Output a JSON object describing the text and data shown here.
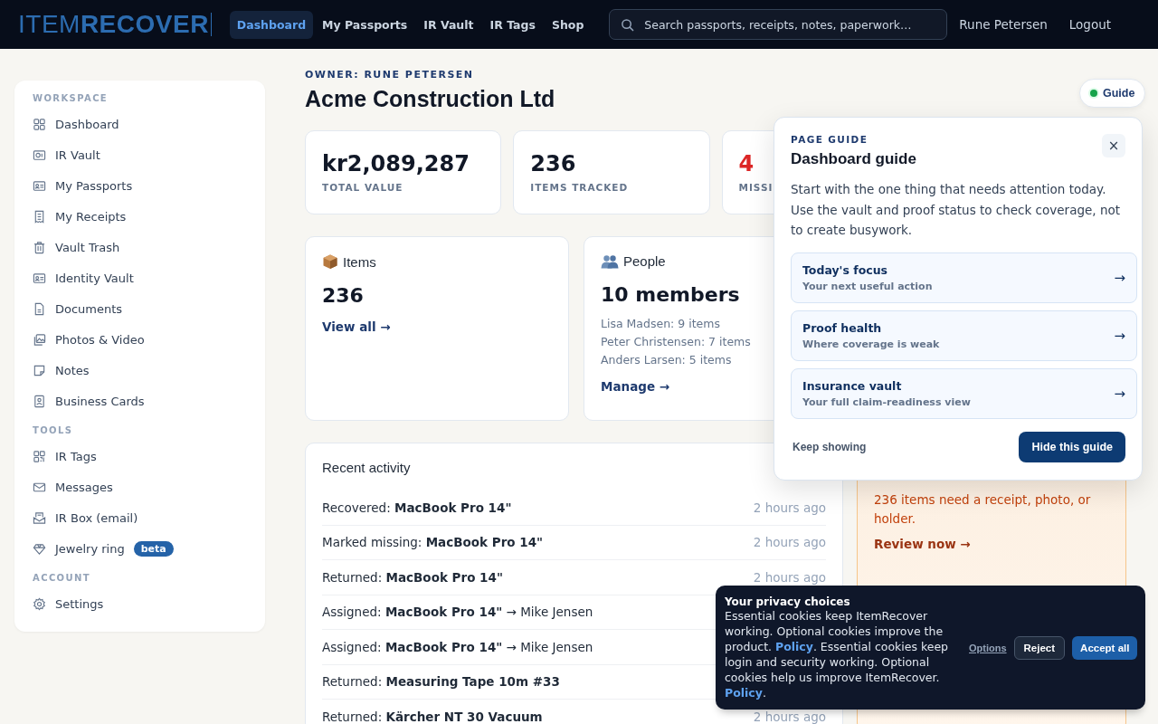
{
  "nav": {
    "logo": "ITEM**RECOVER**",
    "tabs": [
      {
        "label": "Dashboard",
        "selected": true
      },
      {
        "label": "My Passports",
        "selected": false
      },
      {
        "label": "IR Vault",
        "selected": false
      },
      {
        "label": "IR Tags",
        "selected": false
      },
      {
        "label": "Shop",
        "selected": false
      }
    ],
    "search": {
      "placeholder": "Search passports, receipts, notes, paperwork…"
    },
    "user": "Rune Petersen",
    "logout": "Logout"
  },
  "sidebar": {
    "sections": [
      {
        "heading": "WORKSPACE",
        "items": [
          {
            "label": "Dashboard"
          },
          {
            "label": "IR Vault"
          },
          {
            "label": "My Passports"
          },
          {
            "label": "My Receipts"
          },
          {
            "label": "Vault Trash"
          },
          {
            "label": "Identity Vault"
          },
          {
            "label": "Documents"
          },
          {
            "label": "Photos & Video"
          },
          {
            "label": "Notes"
          },
          {
            "label": "Business Cards"
          }
        ]
      },
      {
        "heading": "TOOLS",
        "items": [
          {
            "label": "IR Tags"
          },
          {
            "label": "Messages"
          },
          {
            "label": "IR Box (email)"
          },
          {
            "label": "Jewelry ring",
            "badge": "beta"
          }
        ]
      },
      {
        "heading": "ACCOUNT",
        "items": [
          {
            "label": "Settings"
          }
        ]
      }
    ]
  },
  "header": {
    "owner": "OWNER: RUNE PETERSEN",
    "title": "Acme Construction Ltd"
  },
  "stats": [
    {
      "value": "kr2,089,287",
      "label": "TOTAL VALUE",
      "alert": false
    },
    {
      "value": "236",
      "label": "ITEMS TRACKED",
      "alert": false
    },
    {
      "value": "4",
      "label": "MISSI",
      "alert": true
    }
  ],
  "items_card": {
    "title": "Items",
    "count": "236",
    "link": "View all →"
  },
  "people_card": {
    "title": "People",
    "count": "10 members",
    "members": [
      "Lisa Madsen: 9 items",
      "Peter Christensen: 7 items",
      "Anders Larsen: 5 items"
    ],
    "link": "Manage →"
  },
  "activity": {
    "title": "Recent activity",
    "rows": [
      {
        "text": "Recovered: **MacBook Pro 14\"**",
        "time": "2 hours ago"
      },
      {
        "text": "Marked missing: **MacBook Pro 14\"**",
        "time": "2 hours ago"
      },
      {
        "text": "Returned: **MacBook Pro 14\"**",
        "time": "2 hours ago"
      },
      {
        "text": "Assigned: **MacBook Pro 14\"** → Mike Jensen"
      },
      {
        "text": "Assigned: **MacBook Pro 14\"** → Mike Jensen"
      },
      {
        "text": "Returned: **Measuring Tape 10m #33**"
      },
      {
        "text": "Returned: **Kärcher NT 30 Vacuum**",
        "time": "2 hours ago"
      }
    ]
  },
  "proof_card": {
    "message": "236 items need a receipt, photo, or holder.",
    "link": "Review now →"
  },
  "guide_button": {
    "label": "Guide"
  },
  "guide": {
    "eyebrow": "PAGE GUIDE",
    "title": "Dashboard guide",
    "close": "×",
    "body": "Start with the one thing that needs attention today. Use the vault and proof status to check coverage, not to create busywork.",
    "links": [
      {
        "title": "Today's focus",
        "subtitle": "Your next useful action",
        "arrow": "→"
      },
      {
        "title": "Proof health",
        "subtitle": "Where coverage is weak",
        "arrow": "→"
      },
      {
        "title": "Insurance vault",
        "subtitle": "Your full claim-readiness view",
        "arrow": "→"
      }
    ],
    "secondary": "Keep showing",
    "primary": "Hide this guide"
  },
  "cookies": {
    "title": "Your privacy choices",
    "segments": [
      {
        "kind": "text",
        "text": "Essential cookies keep ItemRecover working. Optional cookies improve the product. "
      },
      {
        "kind": "link",
        "text": "Policy"
      },
      {
        "kind": "text",
        "text": ". Essential cookies keep login and security working. Optional cookies help us improve ItemRecover. "
      },
      {
        "kind": "link",
        "text": "Policy"
      },
      {
        "kind": "text",
        "text": "."
      }
    ],
    "options": "Options",
    "reject": "Reject",
    "accept": "Accept all"
  }
}
